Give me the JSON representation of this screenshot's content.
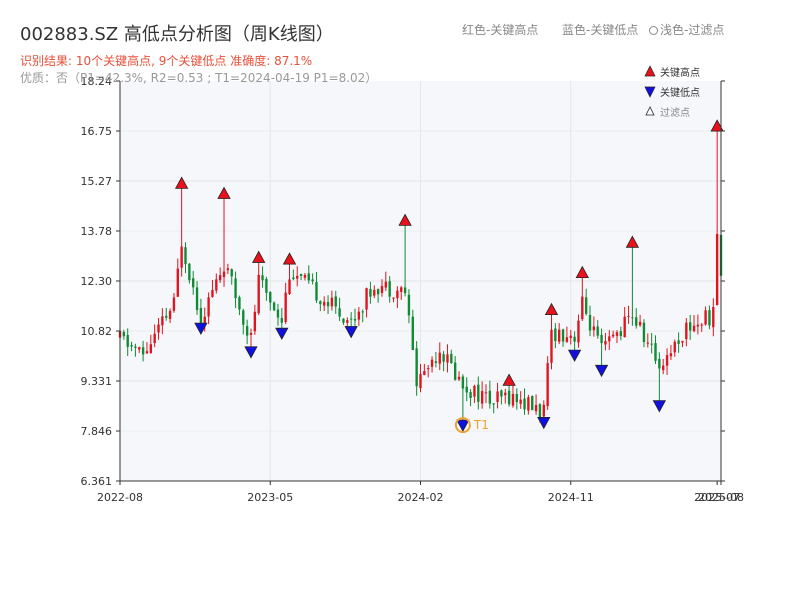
{
  "header": {
    "title": "002883.SZ 高低点分析图（周K线图）",
    "legend_red": "红色-关键高点",
    "legend_blue": "蓝色-关键低点",
    "legend_filtered": "浅色-过滤点",
    "result_line": "识别结果: 10个关键高点, 9个关键低点  准确度: 87.1%",
    "quality_line": "优质：否（P1=42.3%, R2=0.53 ; T1=2024-04-19 P1=8.02）"
  },
  "colors": {
    "up": "#e0141e",
    "down": "#0f8a35",
    "high_marker": "#e8111c",
    "low_marker": "#1010e0",
    "t1_marker": "#f0a030",
    "plot_bg": "#f5f7fa",
    "grid": "#e3e6ea",
    "axis": "#333333"
  },
  "chart_data": {
    "type": "candlestick",
    "y_axis": {
      "min": 6.361,
      "max": 18.24,
      "ticks": [
        "6.361",
        "7.846",
        "9.331",
        "10.82",
        "12.30",
        "13.78",
        "15.27",
        "16.75",
        "18.24"
      ],
      "tick_values": [
        6.361,
        7.846,
        9.331,
        10.816,
        12.301,
        13.786,
        15.271,
        16.755,
        18.24
      ]
    },
    "x_axis": {
      "start": "2022-08-05",
      "end": "2025-08-01",
      "ticks": [
        {
          "label": "2022-08",
          "date": "2022-08-05"
        },
        {
          "label": "2023-05",
          "date": "2023-05-05"
        },
        {
          "label": "2024-02",
          "date": "2024-02-02"
        },
        {
          "label": "2024-11",
          "date": "2024-11-01"
        },
        {
          "label": "2025-07",
          "date": "2025-07-25"
        },
        {
          "label": "2025-08",
          "date": "2025-08-01"
        }
      ]
    },
    "key_highs": [
      {
        "date": "2022-11-25",
        "value": 15.2
      },
      {
        "date": "2023-02-10",
        "value": 14.9
      },
      {
        "date": "2023-04-14",
        "value": 13.0
      },
      {
        "date": "2023-06-09",
        "value": 12.95
      },
      {
        "date": "2024-01-05",
        "value": 14.1
      },
      {
        "date": "2024-07-12",
        "value": 9.35
      },
      {
        "date": "2024-09-27",
        "value": 11.45
      },
      {
        "date": "2024-11-22",
        "value": 12.55
      },
      {
        "date": "2025-02-21",
        "value": 13.45
      },
      {
        "date": "2025-07-25",
        "value": 16.9
      }
    ],
    "key_lows": [
      {
        "date": "2022-12-30",
        "value": 10.9
      },
      {
        "date": "2023-03-31",
        "value": 10.2
      },
      {
        "date": "2023-05-26",
        "value": 10.75
      },
      {
        "date": "2023-09-29",
        "value": 10.8
      },
      {
        "date": "2024-04-19",
        "value": 8.02
      },
      {
        "date": "2024-09-13",
        "value": 8.1
      },
      {
        "date": "2024-11-08",
        "value": 10.1
      },
      {
        "date": "2024-12-27",
        "value": 9.65
      },
      {
        "date": "2025-04-11",
        "value": 8.6
      }
    ],
    "t1_label": "T1",
    "t1_date": "2024-04-19",
    "t1_value": 8.02,
    "legend": {
      "high_label": "关键高点",
      "low_label": "关键低点",
      "filtered_label": "过滤点"
    },
    "grid": true,
    "legend_position": "top-right",
    "anchors": [
      {
        "date": "2022-08-05",
        "value": 10.6
      },
      {
        "date": "2022-09-16",
        "value": 10.1
      },
      {
        "date": "2022-11-11",
        "value": 11.6
      },
      {
        "date": "2022-11-25",
        "value": 13.5
      },
      {
        "date": "2022-12-30",
        "value": 11.2
      },
      {
        "date": "2023-02-10",
        "value": 12.8
      },
      {
        "date": "2023-03-31",
        "value": 10.6
      },
      {
        "date": "2023-04-14",
        "value": 12.3
      },
      {
        "date": "2023-05-26",
        "value": 11.2
      },
      {
        "date": "2023-06-09",
        "value": 12.6
      },
      {
        "date": "2023-09-29",
        "value": 11.1
      },
      {
        "date": "2023-11-10",
        "value": 12.2
      },
      {
        "date": "2024-01-05",
        "value": 12.0
      },
      {
        "date": "2024-01-26",
        "value": 9.3
      },
      {
        "date": "2024-03-08",
        "value": 10.3
      },
      {
        "date": "2024-04-19",
        "value": 9.2
      },
      {
        "date": "2024-06-14",
        "value": 8.7
      },
      {
        "date": "2024-07-12",
        "value": 8.9
      },
      {
        "date": "2024-09-13",
        "value": 8.4
      },
      {
        "date": "2024-09-27",
        "value": 10.8
      },
      {
        "date": "2024-11-08",
        "value": 10.7
      },
      {
        "date": "2024-11-22",
        "value": 11.6
      },
      {
        "date": "2024-12-27",
        "value": 10.2
      },
      {
        "date": "2025-02-21",
        "value": 11.3
      },
      {
        "date": "2025-04-11",
        "value": 9.8
      },
      {
        "date": "2025-05-30",
        "value": 10.9
      },
      {
        "date": "2025-07-18",
        "value": 11.3
      },
      {
        "date": "2025-07-25",
        "value": 13.8
      },
      {
        "date": "2025-08-01",
        "value": 12.5
      }
    ]
  }
}
